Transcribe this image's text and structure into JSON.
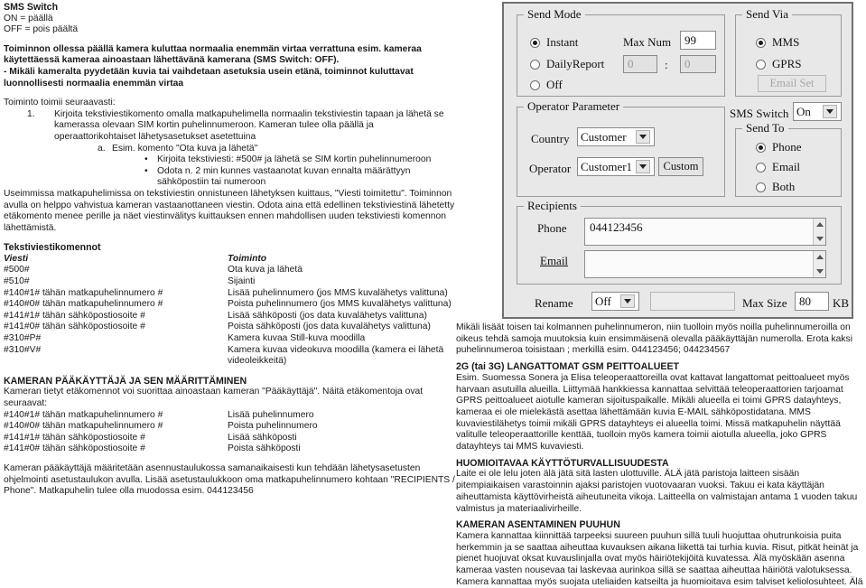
{
  "left_column": {
    "title": "SMS Switch",
    "on_line": "ON = päällä",
    "off_line": "OFF = pois päältä",
    "bold_para_1": "Toiminnon ollessa päällä kamera kuluttaa normaalia enemmän virtaa verrattuna esim. kameraa käytettäessä kameraa ainoastaan lähettävänä kamerana (SMS Switch: OFF).",
    "bold_para_2": "- Mikäli kameralta pyydetään kuvia tai vaihdetaan asetuksia usein etänä, toiminnot kuluttavat luonnollisesti normaalia enemmän virtaa",
    "intro": "Toiminto toimii seuraavasti:",
    "step_1_marker": "1.",
    "step_1": "Kirjoita tekstiviestikomento omalla matkapuhelimella normaalin tekstiviestin tapaan ja lähetä se kamerassa olevaan SIM kortin puhelinnumeroon. Kameran tulee olla päällä ja operaattorikohtaiset lähetysasetukset asetettuina",
    "step_a_marker": "a.",
    "step_a": "Esim. komento \"Ota kuva ja lähetä\"",
    "bullet_marker": "•",
    "bullet_1": "Kirjoita tekstiviesti: #500# ja lähetä se SIM kortin puhelinnumeroon",
    "bullet_2": "Odota n. 2 min kunnes vastaanotat kuvan ennalta määrättyyn sähköpostiin tai numeroon",
    "para_after": "Useimmissa matkapuhelimissa on tekstiviestin onnistuneen lähetyksen kuittaus, \"Viesti toimitettu\". Toiminnon avulla on helppo vahvistua kameran vastaanottaneen viestin. Odota aina että edellinen tekstiviestinä lähetetty etäkomento menee perille ja näet viestinvälitys kuittauksen ennen mahdollisen uuden tekstiviesti komennon lähettämistä.",
    "commands_heading": "Tekstiviestikomennot",
    "commands_header_1": "Viesti",
    "commands_header_2": "Toiminto",
    "commands": [
      {
        "msg": "#500#",
        "action": "Ota kuva ja lähetä"
      },
      {
        "msg": "#510#",
        "action": "Sijainti"
      },
      {
        "msg": "#140#1# tähän matkapuhelinnumero #",
        "action": "Lisää puhelinnumero  (jos MMS kuvalähetys valittuna)"
      },
      {
        "msg": "#140#0# tähän matkapuhelinnumero #",
        "action": "Poista puhelinnumero  (jos MMS kuvalähetys valittuna)"
      },
      {
        "msg": "#141#1# tähän sähköpostiosoite #",
        "action": "Lisää sähköposti  (jos data  kuvalähetys valittuna)"
      },
      {
        "msg": "#141#0# tähän sähköpostiosoite #",
        "action": "Poista sähköposti (jos data kuvalähetys valittuna)"
      },
      {
        "msg": "#310#P#",
        "action": "Kamera kuvaa Still-kuva moodilla"
      },
      {
        "msg": "#310#V#",
        "action": "Kamera kuvaa videokuva moodilla (kamera ei lähetä videoleikkeitä)"
      }
    ],
    "admin_heading": "KAMERAN PÄÄKÄYTTÄJÄ JA SEN MÄÄRITTÄMINEN",
    "admin_intro": "Kameran tietyt etäkomennot  voi suorittaa ainoastaan kameran \"Pääkäyttäjä\". Näitä etäkomentoja ovat seuraavat:",
    "admin_commands": [
      {
        "msg": "#140#1# tähän matkapuhelinnumero #",
        "action": "Lisää puhelinnumero"
      },
      {
        "msg": "#140#0# tähän matkapuhelinnumero #",
        "action": "Poista puhelinnumero"
      },
      {
        "msg": "#141#1# tähän sähköpostiosoite #",
        "action": "Lisää sähköposti"
      },
      {
        "msg": "#141#0# tähän sähköpostiosoite #",
        "action": "Poista sähköposti"
      }
    ],
    "admin_outro": "Kameran pääkäyttäjä määritetään asennustaulukossa samanaikaisesti kun tehdään lähetysasetusten ohjelmointi asetustaulukon avulla. Lisää asetustaulukkoon oma matkapuhelinnumero kohtaan \"RECIPIENTS / Phone\". Matkapuhelin tulee olla muodossa esim. 044123456"
  },
  "right_column": {
    "para_1": "Mikäli lisäät toisen tai kolmannen puhelinnumeron, niin tuolloin myös noilla puhelinnumeroilla on oikeus tehdä samoja muutoksia kuin ensimmäisenä olevalla pääkäyttäjän numerolla. Erota kaksi puhelinnumeroa toisistaan ; merkillä esim. 044123456; 044234567",
    "heading_2g": "2G (tai 3G) LANGATTOMAT GSM PEITTOALUEET",
    "para_2g": "Esim. Suomessa Sonera ja Elisa teleoperaattoreilla ovat kattavat langattomat peittoalueet myös harvaan asutuilla alueilla. Liittymää hankkiessa kannattaa selvittää teleoperaattorien tarjoamat GPRS peittoalueet aiotulle kameran sijoituspaikalle. Mikäli alueella ei toimi GPRS datayhteys, kameraa ei ole mielekästä asettaa lähettämään kuvia E-MAIL sähköpostidatana. MMS kuvaviestilähetys toimii mikäli GPRS datayhteys ei alueella toimi. Missä matkapuhelin näyttää valitulle teleoperaattorille kenttää, tuolloin myös kamera toimii aiotulla alueella, joko GPRS datayhteys tai MMS kuvaviesti.",
    "heading_safety": "HUOMIOITAVAA KÄYTTÖTURVALLISUUDESTA",
    "para_safety": "Laite ei ole lelu joten älä jätä sitä lasten ulottuville. ÄLÄ jätä paristoja laitteen sisään pitempiaikaisen varastoinnin ajaksi paristojen vuotovaaran vuoksi. Takuu ei kata käyttäjän aiheuttamista käyttövirheistä aiheutuneita vikoja. Laitteella on valmistajan antama 1 vuoden takuu valmistus ja materiaalivirheille.",
    "heading_tree": "KAMERAN ASENTAMINEN PUUHUN",
    "para_tree": "Kamera kannattaa kiinnittää tarpeeksi suureen puuhun sillä tuuli huojuttaa ohutrunkoisia puita herkemmin ja se saattaa aiheuttaa kuvauksen aikana liikettä tai turhia kuvia. Risut, pitkät heinät ja pienet huojuvat oksat kuvauslinjalla ovat myös häiriötekijöitä kuvatessa. Älä myöskään asenna kameraa vasten nousevaa tai laskevaa aurinkoa sillä se saattaa aiheuttaa häiriötä valotuksessa. Kamera kannattaa myös suojata uteliaiden katseilta ja huomioitava esim talviset keliolosuhteet. Älä"
  },
  "dialog": {
    "send_mode": {
      "legend": "Send Mode",
      "options": [
        {
          "label": "Instant",
          "selected": true
        },
        {
          "label": "DailyReport",
          "selected": false
        },
        {
          "label": "Off",
          "selected": false
        }
      ],
      "max_num_label": "Max Num",
      "max_num_value": "99",
      "daily_hour": "0",
      "daily_sep": ":",
      "daily_minute": "0"
    },
    "send_via": {
      "legend": "Send Via",
      "options": [
        {
          "label": "MMS",
          "selected": true
        },
        {
          "label": "GPRS",
          "selected": false
        }
      ],
      "email_set_button": "Email Set"
    },
    "operator_parameter": {
      "legend": "Operator Parameter",
      "country_label": "Country",
      "country_value": "Customer",
      "operator_label": "Operator",
      "operator_value": "Customer1",
      "custom_button": "Custom"
    },
    "sms_switch": {
      "label": "SMS Switch",
      "value": "On"
    },
    "send_to": {
      "legend": "Send To",
      "options": [
        {
          "label": "Phone",
          "selected": true
        },
        {
          "label": "Email",
          "selected": false
        },
        {
          "label": "Both",
          "selected": false
        }
      ]
    },
    "recipients": {
      "legend": "Recipients",
      "phone_label": "Phone",
      "phone_value": "044123456",
      "email_label": "Email",
      "email_value": ""
    },
    "footer": {
      "rename_label": "Rename",
      "rename_value": "Off",
      "rename_text": "",
      "max_size_label": "Max Size",
      "max_size_value": "80",
      "max_size_unit": "KB"
    }
  }
}
